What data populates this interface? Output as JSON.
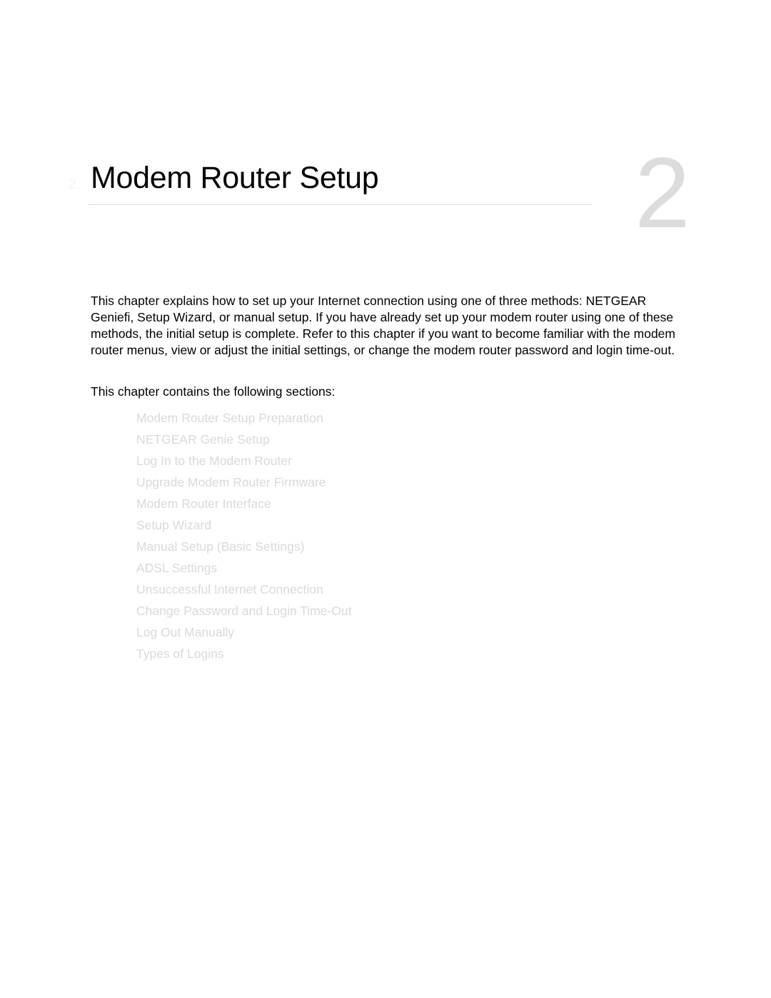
{
  "chapter": {
    "prefix": "2.",
    "title": "Modem Router Setup",
    "number": "2"
  },
  "intro": {
    "paragraph": "This chapter explains how to set up your Internet connection using one of three methods: NETGEAR Geniefi, Setup Wizard, or manual setup. If you have already set up your modem router using one of these methods, the initial setup is complete. Refer to this chapter if you want to become familiar with the modem router menus, view or adjust the initial settings, or change the modem router password and login time-out.",
    "sections_lead": "This chapter contains the following sections:"
  },
  "sections": [
    {
      "label": "Modem Router Setup Preparation"
    },
    {
      "label": "NETGEAR Genie Setup"
    },
    {
      "label": "Log In to the Modem Router"
    },
    {
      "label": "Upgrade Modem Router Firmware"
    },
    {
      "label": "Modem Router Interface"
    },
    {
      "label": "Setup Wizard"
    },
    {
      "label": "Manual Setup (Basic Settings)"
    },
    {
      "label": "ADSL Settings"
    },
    {
      "label": "Unsuccessful Internet Connection"
    },
    {
      "label": "Change Password and Login Time-Out"
    },
    {
      "label": "Log Out Manually"
    },
    {
      "label": "Types of Logins"
    }
  ],
  "colors": {
    "link": "#d9d9d9",
    "chapter_number": "#dcdcdc",
    "rule": "#dddddd"
  }
}
